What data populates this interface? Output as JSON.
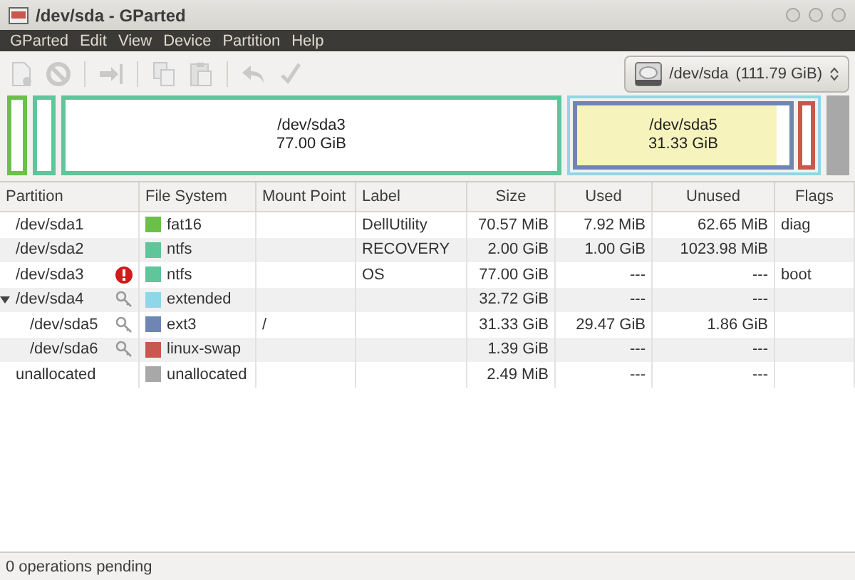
{
  "window": {
    "title": "/dev/sda - GParted"
  },
  "menu": [
    "GParted",
    "Edit",
    "View",
    "Device",
    "Partition",
    "Help"
  ],
  "toolbar": [
    {
      "kind": "new",
      "disabled": true
    },
    {
      "kind": "delete",
      "disabled": true
    },
    {
      "kind": "resize",
      "disabled": true
    },
    {
      "kind": "copy",
      "disabled": true
    },
    {
      "kind": "paste",
      "disabled": true
    },
    {
      "kind": "undo",
      "disabled": true
    },
    {
      "kind": "apply",
      "disabled": true
    }
  ],
  "device": {
    "name": "/dev/sda",
    "size": "(111.79 GiB)"
  },
  "disk_map": [
    {
      "kind": "primary",
      "color": "#6cc04a"
    },
    {
      "kind": "primary",
      "color": "#5fc59a"
    },
    {
      "kind": "primary",
      "color": "#5fc59a",
      "name": "/dev/sda3",
      "size": "77.00 GiB"
    },
    {
      "kind": "extended",
      "color": "#8fd7e8",
      "children": [
        {
          "kind": "logical",
          "color": "#6f86b4",
          "name": "/dev/sda5",
          "size": "31.33 GiB",
          "level": 0.94
        },
        {
          "kind": "logical",
          "color": "#c8584f"
        }
      ]
    },
    {
      "kind": "unallocated",
      "color": "#a8a8a8"
    }
  ],
  "table": {
    "columns": [
      "Partition",
      "File System",
      "Mount Point",
      "Label",
      "Size",
      "Used",
      "Unused",
      "Flags"
    ],
    "rows": [
      {
        "partition": "/dev/sda1",
        "kind": "plain",
        "filesystem": "fat16",
        "color": "#6cc04a",
        "label": "DellUtility",
        "size": "70.57 MiB",
        "used": "7.92 MiB",
        "unused": "62.65 MiB",
        "flags": "diag"
      },
      {
        "partition": "/dev/sda2",
        "kind": "plain",
        "filesystem": "ntfs",
        "color": "#5fc59a",
        "label": "RECOVERY",
        "size": "2.00 GiB",
        "used": "1.00 GiB",
        "unused": "1023.98 MiB"
      },
      {
        "partition": "/dev/sda3",
        "kind": "warning",
        "filesystem": "ntfs",
        "color": "#5fc59a",
        "label": "OS",
        "size": "77.00 GiB",
        "used": "---",
        "unused": "---",
        "flags": "boot"
      },
      {
        "partition": "/dev/sda4",
        "kind": "key",
        "expanded": true,
        "filesystem": "extended",
        "color": "#8fd7e8",
        "size": "32.72 GiB",
        "used": "---",
        "unused": "---",
        "children": [
          {
            "partition": "/dev/sda5",
            "kind": "key",
            "filesystem": "ext3",
            "color": "#6f86b4",
            "mount": "/",
            "size": "31.33 GiB",
            "used": "29.47 GiB",
            "unused": "1.86 GiB"
          },
          {
            "partition": "/dev/sda6",
            "kind": "key",
            "filesystem": "linux-swap",
            "color": "#c8584f",
            "size": "1.39 GiB",
            "used": "---",
            "unused": "---"
          }
        ]
      },
      {
        "partition": "unallocated",
        "kind": "plain",
        "filesystem": "unallocated",
        "color": "#a8a8a8",
        "size": "2.49 MiB",
        "used": "---",
        "unused": "---"
      }
    ]
  },
  "status_bar": "0 operations pending"
}
